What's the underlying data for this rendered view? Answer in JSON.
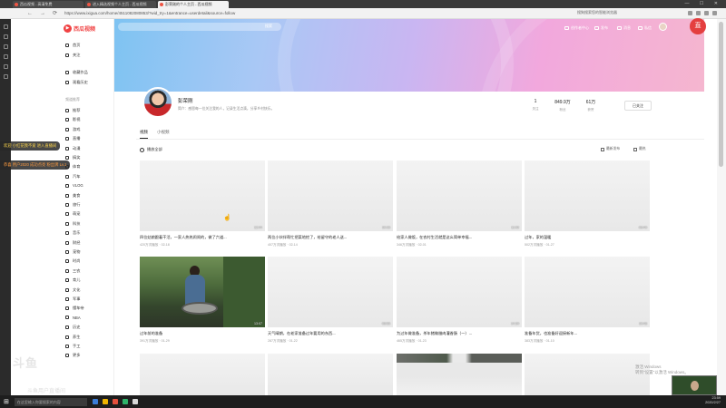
{
  "browser": {
    "tabs": [
      "西瓜视频 - 高清免费",
      "进入精选视频个人主页 - 西瓜视频",
      "彭荣刚的个人主页 - 西瓜视频"
    ],
    "url": "https://www.ixigua.com/home/4511082080853/?wid_try=1&entrance=userdetail&source=follow",
    "address_right": "搜狗搜索您的智能浏览器",
    "nav": {
      "back": "←",
      "forward": "→",
      "reload": "⟳"
    }
  },
  "site": {
    "logo_text": "西瓜视频",
    "search_button": "搜索",
    "top_menu": [
      "创作者中心",
      "发布",
      "消息",
      "私信",
      "历史",
      "设置"
    ]
  },
  "nav": {
    "top": [
      "首页",
      "关注"
    ],
    "mid": [
      "收藏作品",
      "观看历史"
    ],
    "section_title": "频道推荐",
    "channels": [
      "推荐",
      "影视",
      "游戏",
      "直播",
      "动漫",
      "搞笑",
      "体育",
      "汽车",
      "VLOG",
      "美食",
      "旅行",
      "萌宠",
      "科技",
      "音乐",
      "财经",
      "宠物",
      "时尚",
      "三农",
      "育儿",
      "文化",
      "军事",
      "懂车帝",
      "NBA",
      "历史",
      "养生",
      "手工",
      "更多"
    ]
  },
  "profile": {
    "name": "彭荣刚",
    "description": "简介：感恩每一位关注我的人，记录生活点滴，分享乡村快乐。",
    "stats": [
      {
        "num": "1",
        "label": "关注"
      },
      {
        "num": "849.9万",
        "label": "粉丝"
      },
      {
        "num": "61万",
        "label": "获赞"
      }
    ],
    "follow_button": "已关注"
  },
  "tabs": [
    "视频",
    "小视频"
  ],
  "toolbar": {
    "play_all": "播放全部",
    "sort_latest": "最新发布",
    "sort_hot": "最热"
  },
  "videos": [
    {
      "title": "四位姑娘跟着干活，一家人热热闹闹的，做了六道...",
      "meta": "420万次播放 · 02-18",
      "dur": "12:44"
    },
    {
      "title": "两位小伙伴帮忙把菜地挖了，给留守的老人送...",
      "meta": "407万次播放 · 02-14",
      "dur": "10:15"
    },
    {
      "title": "给家人做饭，在农村生活就是这么简单幸福...",
      "meta": "346万次播放 · 02-01",
      "dur": "11:02"
    },
    {
      "title": "过年，家的温暖",
      "meta": "502万次播放 · 01-27",
      "dur": "09:40"
    },
    {
      "title": "过年前的准备",
      "meta": "391万次播放 · 01-29",
      "dur": "13:07"
    },
    {
      "title": "天气晴朗，在老家准备过年要用的东西...",
      "meta": "287万次播放 · 01-22",
      "dur": "08:55"
    },
    {
      "title": "为过年做准备，杀年猪做腊肉灌香肠（一）...",
      "meta": "465万次播放 · 01-23",
      "dur": "14:20"
    },
    {
      "title": "准备年货，也准备好迎接新年...",
      "meta": "383万次播放 · 01-10",
      "dur": "10:48"
    }
  ],
  "chat": [
    {
      "text": "欢迎 小红花我不爱 进入直播间"
    },
    {
      "text": "恭喜 用户2020 成功点亮 粉丝牌 Lv.1"
    }
  ],
  "overlay": {
    "watermark_logo": "斗鱼",
    "watermark_user": "斗鱼用户直播间",
    "activate_line1": "激活 Windows",
    "activate_line2": "转到\"设置\"以激活 Windows。",
    "live_logo": "直"
  },
  "taskbar": {
    "start": "⊞",
    "search": "在这里输入你要搜索的内容",
    "time": "23:59",
    "date": "2020/2/27"
  },
  "colors": {
    "brand": "#f04142",
    "chat_yellow": "#ffd84d",
    "chat_orange": "#ff9c40"
  }
}
